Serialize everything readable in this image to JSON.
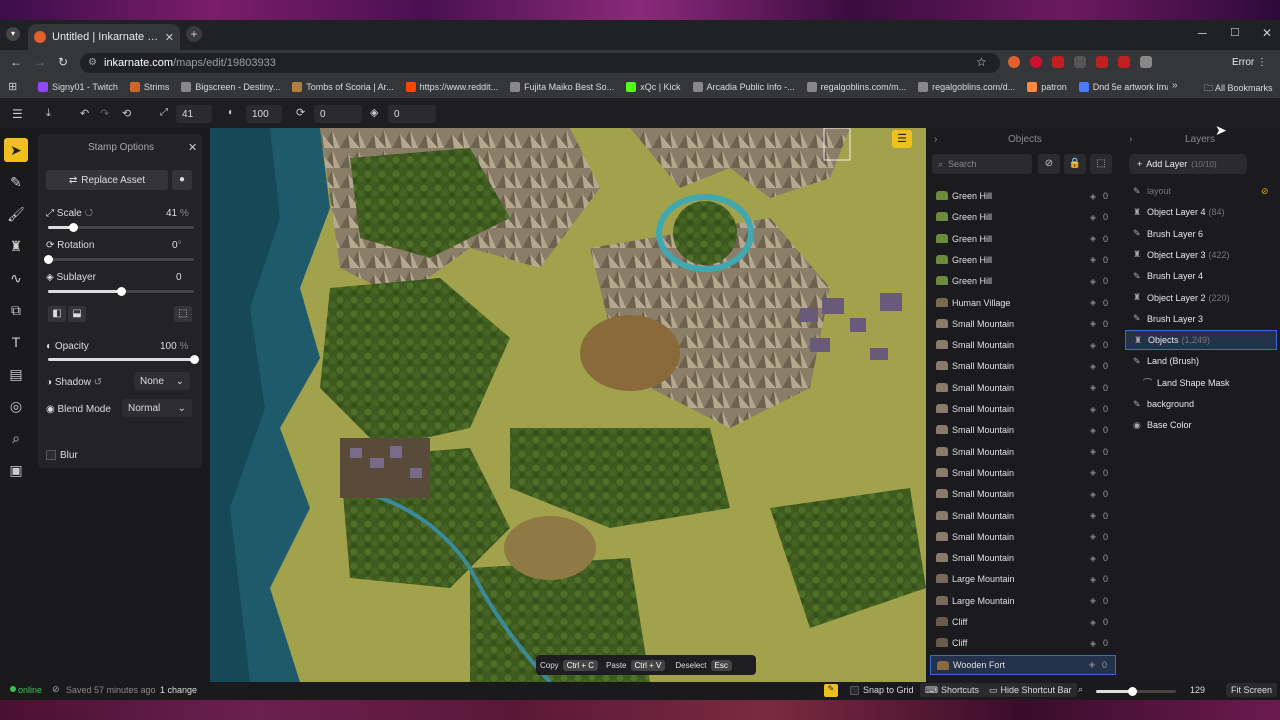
{
  "browser": {
    "tab_title": "Untitled | Inkarnate - Create Fa",
    "url_domain": "inkarnate.com",
    "url_path": "/maps/edit/19803933",
    "profile_status": "Error",
    "bookmarks": [
      {
        "label": "Signy01 - Twitch",
        "color": "#9146ff"
      },
      {
        "label": "Strims",
        "color": "#d0642a"
      },
      {
        "label": "Bigscreen - Destiny...",
        "color": "#888888"
      },
      {
        "label": "Tombs of Scoria | Ar...",
        "color": "#b08040"
      },
      {
        "label": "https://www.reddit...",
        "color": "#ff4500"
      },
      {
        "label": "Fujita Maiko Best So...",
        "color": "#888888"
      },
      {
        "label": "xQc | Kick",
        "color": "#53fc18"
      },
      {
        "label": "Arcadia Public Info -...",
        "color": "#888888"
      },
      {
        "label": "regalgoblins.com/m...",
        "color": "#888888"
      },
      {
        "label": "regalgoblins.com/d...",
        "color": "#888888"
      },
      {
        "label": "patron",
        "color": "#ff8a3c"
      },
      {
        "label": "Dnd 5e artwork Ima...",
        "color": "#4a7aff"
      }
    ],
    "all_bookmarks": "All Bookmarks"
  },
  "toolbar": {
    "scale": "41",
    "opacity": "100",
    "rotation": "0",
    "sublayer": "0"
  },
  "stamp": {
    "title": "Stamp Options",
    "replace": "Replace Asset",
    "scale_label": "Scale",
    "scale_val": "41",
    "scale_unit": "%",
    "rotation_label": "Rotation",
    "rotation_val": "0",
    "rotation_unit": "°",
    "sublayer_label": "Sublayer",
    "sublayer_val": "0",
    "opacity_label": "Opacity",
    "opacity_val": "100",
    "opacity_unit": "%",
    "shadow_label": "Shadow",
    "shadow_val": "None",
    "blend_label": "Blend Mode",
    "blend_val": "Normal",
    "blur_label": "Blur",
    "scale_level": 0.17,
    "rotation_level": 0.0,
    "sublayer_level": 0.5,
    "opacity_level": 1.0
  },
  "objects": {
    "header": "Objects",
    "search_placeholder": "Search",
    "items": [
      {
        "name": "Green Hill",
        "count": "0",
        "color": "#6b8a3a"
      },
      {
        "name": "Green Hill",
        "count": "0",
        "color": "#6b8a3a"
      },
      {
        "name": "Green Hill",
        "count": "0",
        "color": "#6b8a3a"
      },
      {
        "name": "Green Hill",
        "count": "0",
        "color": "#6b8a3a"
      },
      {
        "name": "Green Hill",
        "count": "0",
        "color": "#6b8a3a"
      },
      {
        "name": "Human Village",
        "count": "0",
        "color": "#7a6a50"
      },
      {
        "name": "Small Mountain",
        "count": "0",
        "color": "#8a7a6a"
      },
      {
        "name": "Small Mountain",
        "count": "0",
        "color": "#8a7a6a"
      },
      {
        "name": "Small Mountain",
        "count": "0",
        "color": "#8a7a6a"
      },
      {
        "name": "Small Mountain",
        "count": "0",
        "color": "#8a7a6a"
      },
      {
        "name": "Small Mountain",
        "count": "0",
        "color": "#8a7a6a"
      },
      {
        "name": "Small Mountain",
        "count": "0",
        "color": "#8a7a6a"
      },
      {
        "name": "Small Mountain",
        "count": "0",
        "color": "#8a7a6a"
      },
      {
        "name": "Small Mountain",
        "count": "0",
        "color": "#8a7a6a"
      },
      {
        "name": "Small Mountain",
        "count": "0",
        "color": "#8a7a6a"
      },
      {
        "name": "Small Mountain",
        "count": "0",
        "color": "#8a7a6a"
      },
      {
        "name": "Small Mountain",
        "count": "0",
        "color": "#8a7a6a"
      },
      {
        "name": "Small Mountain",
        "count": "0",
        "color": "#8a7a6a"
      },
      {
        "name": "Large Mountain",
        "count": "0",
        "color": "#7a6a5a"
      },
      {
        "name": "Large Mountain",
        "count": "0",
        "color": "#7a6a5a"
      },
      {
        "name": "Cliff",
        "count": "0",
        "color": "#6a5a4a"
      },
      {
        "name": "Cliff",
        "count": "0",
        "color": "#6a5a4a"
      },
      {
        "name": "Wooden Fort",
        "count": "0",
        "color": "#8a6a40"
      }
    ]
  },
  "layers": {
    "header": "Layers",
    "add": "Add Layer",
    "add_count": "(10/10)",
    "items": [
      {
        "name": "layout",
        "sub": "",
        "icon": "brush"
      },
      {
        "name": "Object Layer 4",
        "sub": "(84)",
        "icon": "object"
      },
      {
        "name": "Brush Layer 6",
        "sub": "",
        "icon": "brush"
      },
      {
        "name": "Object Layer 3",
        "sub": "(422)",
        "icon": "object"
      },
      {
        "name": "Brush Layer 4",
        "sub": "",
        "icon": "brush"
      },
      {
        "name": "Object Layer 2",
        "sub": "(220)",
        "icon": "object"
      },
      {
        "name": "Brush Layer 3",
        "sub": "",
        "icon": "brush"
      },
      {
        "name": "Objects",
        "sub": "(1,249)",
        "icon": "object"
      },
      {
        "name": "Land (Brush)",
        "sub": "",
        "icon": "brush"
      },
      {
        "name": "Land Shape Mask",
        "sub": "",
        "icon": "mask"
      },
      {
        "name": "background",
        "sub": "",
        "icon": "brush"
      },
      {
        "name": "Base Color",
        "sub": "",
        "icon": "palette"
      }
    ]
  },
  "shortcuts": {
    "copy": "Copy",
    "copy_key": "Ctrl + C",
    "paste": "Paste",
    "paste_key": "Ctrl + V",
    "deselect": "Deselect",
    "deselect_key": "Esc"
  },
  "status": {
    "online": "online",
    "saved": "Saved 57 minutes ago",
    "changes": "1 change",
    "snap": "Snap to Grid",
    "shortcuts": "Shortcuts",
    "hide": "Hide Shortcut Bar",
    "zoom": "129",
    "fit": "Fit Screen",
    "zoom_level": 0.45
  }
}
